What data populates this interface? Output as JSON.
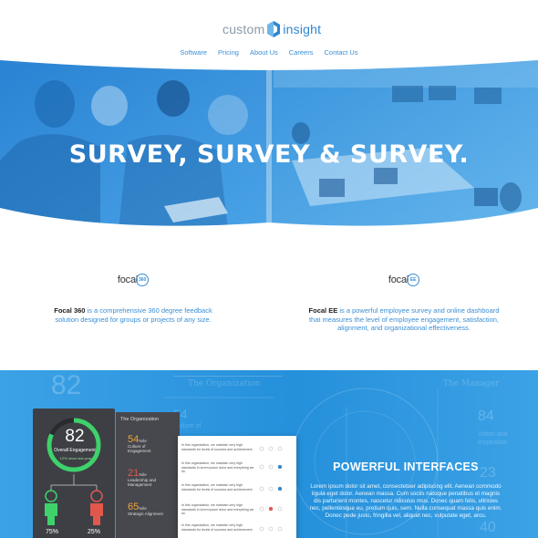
{
  "brand": {
    "word1": "custom",
    "word2": "insight"
  },
  "nav": [
    {
      "label": "Software"
    },
    {
      "label": "Pricing"
    },
    {
      "label": "About Us"
    },
    {
      "label": "Careers"
    },
    {
      "label": "Contact Us"
    }
  ],
  "hero": {
    "title": "SURVEY, SURVEY & SURVEY."
  },
  "products": [
    {
      "logo_name": "focal",
      "logo_badge": "360",
      "name": "Focal 360",
      "description": " is a comprehensive 360 degree feedback solution designed for groups or projects of any size."
    },
    {
      "logo_name": "focal",
      "logo_badge": "EE",
      "name": "Focal EE",
      "description": " is a powerful employee survey and online dashboard that measures the level of employee engagement, satisfaction, alignment, and organizational effectiveness."
    }
  ],
  "interfaces": {
    "title": "POWERFUL INTERFACES",
    "text": "Lorem ipsum dolor sit amet, consectetuer adipiscing elit. Aenean commodo ligula eget dolor. Aenean massa. Cum sociis natoque penatibus et magnis dis parturient montes, nascetur ridiculus mus. Donec quam felis, ultricies nec, pellentesque eu, pretium quis, sem. Nulla consequat massa quis enim. Donec pede justo, fringilla vel, aliquet nec, vulputate eget, arcu."
  },
  "background_labels": {
    "org": "The Organization",
    "manager": "The Manager",
    "big_num": "82",
    "vision_num": "84",
    "vision_lbl": "Vision and Inspiration",
    "num23": "23",
    "num40": "40",
    "num54": "54",
    "culture": "Culture of"
  },
  "dashboard": {
    "score": "82",
    "score_label": "Overall Engagement",
    "score_sub": "12% since last year",
    "panel_title": "The Organization",
    "stats": [
      {
        "value": "54",
        "suffix": "%ile",
        "label": "Culture of Engagement"
      },
      {
        "value": "21",
        "suffix": "%ile",
        "label": "Leadership and Management"
      },
      {
        "value": "65",
        "suffix": "%ile",
        "label": "Strategic Alignment"
      }
    ],
    "left_pct": "75%",
    "right_pct": "25%",
    "row_text": "In this organization, we maintain very high standards for levels of success and achievement.",
    "row_text_short": "In this organization, we maintain very high standards in lorem ipsum dolor and everything we do"
  },
  "colors": {
    "accent": "#2f86d0",
    "band": "#2590db",
    "green": "#3fd16b",
    "red": "#e2574c",
    "orange": "#f2a33a"
  }
}
